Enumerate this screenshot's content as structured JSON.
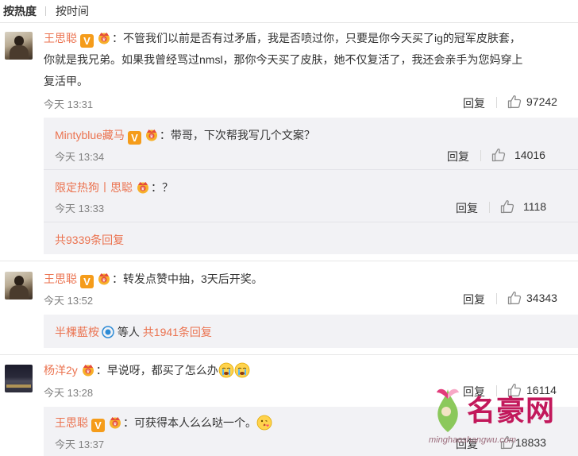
{
  "sort": {
    "hot": "按热度",
    "time": "按时间"
  },
  "labels": {
    "reply": "回复",
    "separator": "："
  },
  "c1": {
    "user": "王思聪",
    "text_l1": "：不管我们以前是否有过矛盾，我是否喷过你，只要是你今天买了ig的冠军皮肤套，",
    "text_l2": "你就是我兄弟。如果我曾经骂过nmsl，那你今天买了皮肤，她不仅复活了，我还会亲手为您妈穿上",
    "text_l3": "复活甲。",
    "time": "今天 13:31",
    "likes": "97242",
    "subs": [
      {
        "user": "Mintyblue藏马",
        "text": "：带哥，下次帮我写几个文案？",
        "time": "今天 13:34",
        "likes": "14016"
      },
      {
        "user": "限定热狗丨思聪",
        "text": "：？",
        "time": "今天 13:33",
        "likes": "1118"
      }
    ],
    "more": "共9339条回复"
  },
  "c2": {
    "user": "王思聪",
    "text": "：转发点赞中抽，3天后开奖。",
    "time": "今天 13:52",
    "likes": "34343",
    "sub_user": "半棵藍桉",
    "sub_mid": " 等人 ",
    "sub_more": "共1941条回复"
  },
  "c3": {
    "user": "杨洋2y",
    "text": "：早说呀，都买了怎么办",
    "time": "今天 13:28",
    "likes": "16114",
    "sub": {
      "user": "王思聪",
      "text": "：可获得本人么么哒一个。",
      "time": "今天 13:37",
      "likes": "18833"
    }
  },
  "watermark": {
    "text": "名豪网",
    "url": "minghaoshangwu.com"
  },
  "icons": {
    "thumb": "thumbs-up-icon",
    "verified": "v-verified-icon",
    "crown": "crown-badge-icon"
  },
  "colors": {
    "name": "#eb7350",
    "verified": "#f59c1a",
    "subbox": "#f2f2f5"
  }
}
